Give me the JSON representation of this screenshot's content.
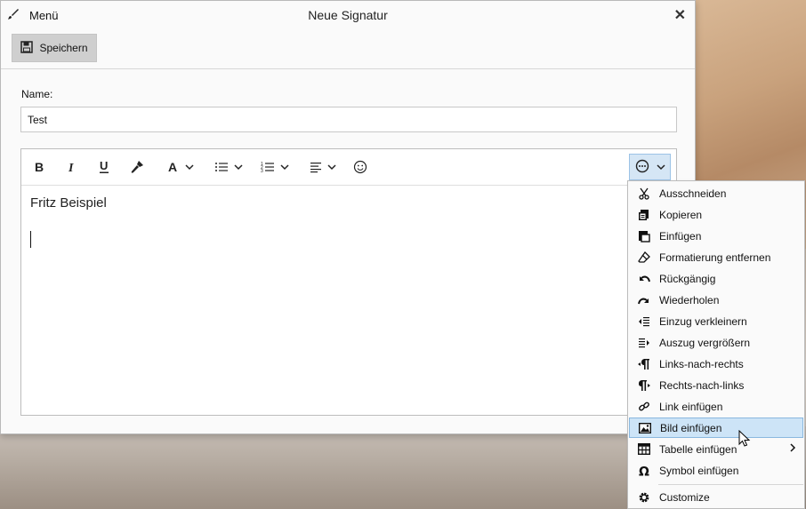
{
  "window": {
    "title": "Neue Signatur",
    "menu_label": "Menü",
    "close_label": "✕",
    "save_label": "Speichern"
  },
  "form": {
    "name_label": "Name:",
    "name_value": "Test"
  },
  "editor": {
    "content_text": "Fritz Beispiel",
    "toolbar_icons": [
      "bold-icon",
      "italic-icon",
      "underline-icon",
      "format-painter-icon",
      "font-color-icon",
      "bullet-list-icon",
      "numbered-list-icon",
      "align-icon",
      "emoji-icon",
      "more-options-icon"
    ]
  },
  "context_menu": {
    "items": [
      {
        "label": "Ausschneiden",
        "icon": "scissors-icon"
      },
      {
        "label": "Kopieren",
        "icon": "copy-icon"
      },
      {
        "label": "Einfügen",
        "icon": "paste-icon"
      },
      {
        "label": "Formatierung entfernen",
        "icon": "eraser-icon"
      },
      {
        "label": "Rückgängig",
        "icon": "undo-icon"
      },
      {
        "label": "Wiederholen",
        "icon": "redo-icon"
      },
      {
        "label": "Einzug verkleinern",
        "icon": "outdent-icon"
      },
      {
        "label": "Auszug vergrößern",
        "icon": "indent-icon"
      },
      {
        "label": "Links-nach-rechts",
        "icon": "ltr-icon"
      },
      {
        "label": "Rechts-nach-links",
        "icon": "rtl-icon"
      },
      {
        "label": "Link einfügen",
        "icon": "link-icon"
      },
      {
        "label": "Bild einfügen",
        "icon": "image-icon",
        "highlighted": true
      },
      {
        "label": "Tabelle einfügen",
        "icon": "table-icon",
        "submenu": true
      },
      {
        "label": "Symbol einfügen",
        "icon": "omega-icon"
      },
      {
        "label": "Customize",
        "icon": "gear-icon"
      }
    ]
  },
  "colors": {
    "highlight": "#cde4f7",
    "highlight_border": "#8ab8df",
    "button_bg": "#cfcfcf"
  }
}
